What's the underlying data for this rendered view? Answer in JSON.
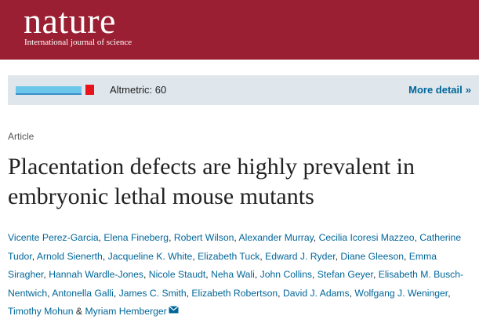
{
  "header": {
    "logo": "nature",
    "subtitle": "International journal of science",
    "background": "#9b1f32"
  },
  "altmetric": {
    "label": "Altmetric: 60",
    "more_detail": "More detail",
    "chevron": "»",
    "link_color": "#006699"
  },
  "article": {
    "type": "Article",
    "title": "Placentation defects are highly prevalent in embryonic lethal mouse mutants"
  },
  "authors": [
    "Vicente Perez-Garcia",
    "Elena Fineberg",
    "Robert Wilson",
    "Alexander Murray",
    "Cecilia Icoresi Mazzeo",
    "Catherine Tudor",
    "Arnold Sienerth",
    "Jacqueline K. White",
    "Elizabeth Tuck",
    "Edward J. Ryder",
    "Diane Gleeson",
    "Emma Siragher",
    "Hannah Wardle-Jones",
    "Nicole Staudt",
    "Neha Wali",
    "John Collins",
    "Stefan Geyer",
    "Elisabeth M. Busch-Nentwich",
    "Antonella Galli",
    "James C. Smith",
    "Elizabeth Robertson",
    "David J. Adams",
    "Wolfgang J. Weninger",
    "Timothy Mohun",
    "Myriam Hemberger"
  ],
  "icons": {
    "corresponding_author": "mail-icon"
  }
}
